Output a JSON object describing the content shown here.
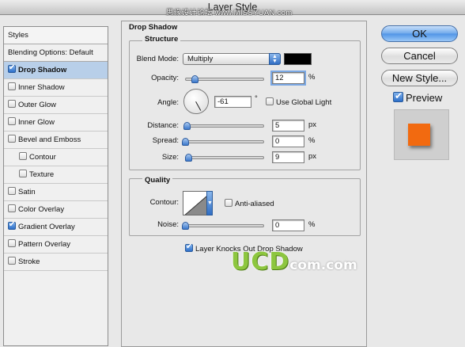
{
  "window": {
    "title": "Layer Style",
    "watermark": "思缘设计论坛 www.MISSYUAN.com"
  },
  "styles": {
    "header": "Styles",
    "items": [
      {
        "label": "Blending Options: Default",
        "checkbox": false,
        "checked": false,
        "selected": false
      },
      {
        "label": "Drop Shadow",
        "checkbox": true,
        "checked": true,
        "selected": true
      },
      {
        "label": "Inner Shadow",
        "checkbox": true,
        "checked": false,
        "selected": false
      },
      {
        "label": "Outer Glow",
        "checkbox": true,
        "checked": false,
        "selected": false
      },
      {
        "label": "Inner Glow",
        "checkbox": true,
        "checked": false,
        "selected": false
      },
      {
        "label": "Bevel and Emboss",
        "checkbox": true,
        "checked": false,
        "selected": false
      },
      {
        "label": "Contour",
        "checkbox": true,
        "checked": false,
        "selected": false,
        "sub": true
      },
      {
        "label": "Texture",
        "checkbox": true,
        "checked": false,
        "selected": false,
        "sub": true
      },
      {
        "label": "Satin",
        "checkbox": true,
        "checked": false,
        "selected": false
      },
      {
        "label": "Color Overlay",
        "checkbox": true,
        "checked": false,
        "selected": false
      },
      {
        "label": "Gradient Overlay",
        "checkbox": true,
        "checked": true,
        "selected": false
      },
      {
        "label": "Pattern Overlay",
        "checkbox": true,
        "checked": false,
        "selected": false
      },
      {
        "label": "Stroke",
        "checkbox": true,
        "checked": false,
        "selected": false
      }
    ]
  },
  "drop_shadow": {
    "title": "Drop Shadow",
    "structure": {
      "title": "Structure",
      "blend_mode_label": "Blend Mode:",
      "blend_mode_value": "Multiply",
      "shadow_color": "#000000",
      "opacity_label": "Opacity:",
      "opacity_value": "12",
      "opacity_unit": "%",
      "opacity_fraction": 0.12,
      "angle_label": "Angle:",
      "angle_value": "-61",
      "angle_unit": "°",
      "use_global_light_label": "Use Global Light",
      "use_global_light_checked": false,
      "distance_label": "Distance:",
      "distance_value": "5",
      "distance_unit": "px",
      "distance_fraction": 0.02,
      "spread_label": "Spread:",
      "spread_value": "0",
      "spread_unit": "%",
      "spread_fraction": 0,
      "size_label": "Size:",
      "size_value": "9",
      "size_unit": "px",
      "size_fraction": 0.04
    },
    "quality": {
      "title": "Quality",
      "contour_label": "Contour:",
      "anti_aliased_label": "Anti-aliased",
      "anti_aliased_checked": false,
      "noise_label": "Noise:",
      "noise_value": "0",
      "noise_unit": "%",
      "noise_fraction": 0
    },
    "knocks_out_label": "Layer Knocks Out Drop Shadow",
    "knocks_out_checked": true
  },
  "buttons": {
    "ok": "OK",
    "cancel": "Cancel",
    "new_style": "New Style...",
    "preview_label": "Preview",
    "preview_checked": true
  },
  "preview": {
    "color": "#f26a10",
    "background": "#cfcfcf"
  },
  "watermark_ucd": {
    "big": "UCD",
    "small": "com.com"
  }
}
